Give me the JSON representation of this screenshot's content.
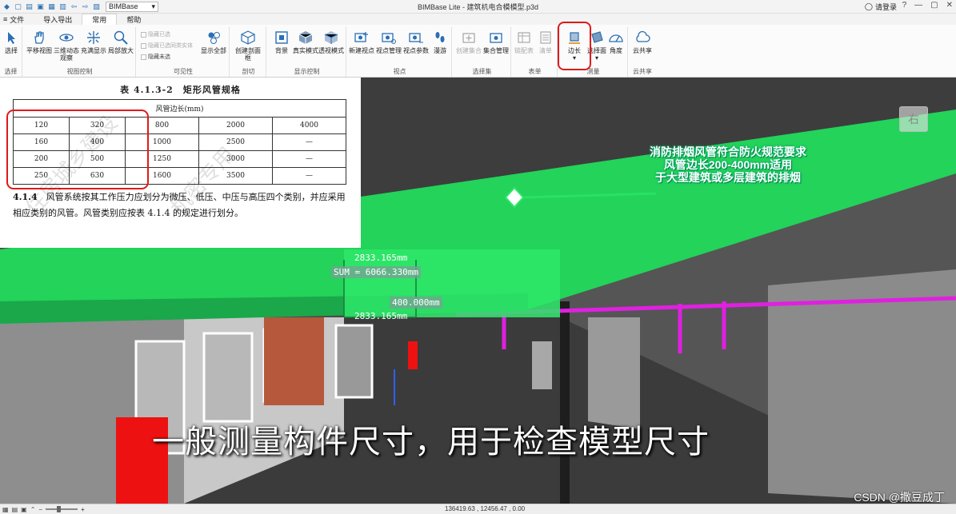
{
  "titlebar": {
    "project_select": "BIMBase",
    "window_title": "BIMBase Lite - 建筑机电合模模型.p3d",
    "login": "请登录"
  },
  "menu": {
    "file": "文件",
    "tabs": [
      "导入导出",
      "常用",
      "帮助"
    ],
    "active_tab": "常用"
  },
  "ribbon": {
    "groups": {
      "select": "选择",
      "view_control": "视图控制",
      "visibility": "可见性",
      "section": "剖切",
      "display_control": "显示控制",
      "viewpoint": "视点",
      "selection_set": "选择集",
      "table": "表单",
      "measure": "测量",
      "cloud": "云共享"
    },
    "buttons": {
      "select": "选择",
      "pan": "平移视图",
      "orbit": "三维动态观察",
      "zoom_fit": "充满显示",
      "zoom_area": "局部放大",
      "hide_selected": "隐藏已选",
      "hide_unselected": "隐藏已选同类实体",
      "hide_unselected2": "隐藏未选",
      "show_all": "显示全部",
      "section_box": "创建剖面框",
      "background": "背景",
      "realistic": "真实模式",
      "perspective": "透视模式",
      "new_viewpoint": "新建视点",
      "viewpoint_manage": "视点管理",
      "viewpoint_params": "视点参数",
      "walk": "漫游",
      "create_set": "创建集合",
      "set_manage": "集合管理",
      "link_form": "链配表",
      "clear_form": "清单",
      "edge_length": "边长",
      "select_face": "选择面",
      "angle": "角度",
      "cloud_share": "云共享"
    }
  },
  "spec_table": {
    "title": "表 4.1.3-2　矩形风管规格",
    "header": "风管边长(mm)",
    "rows": [
      [
        "120",
        "320",
        "800",
        "2000",
        "4000"
      ],
      [
        "160",
        "400",
        "1000",
        "2500",
        "—"
      ],
      [
        "200",
        "500",
        "1250",
        "3000",
        "—"
      ],
      [
        "250",
        "630",
        "1600",
        "3500",
        "—"
      ]
    ],
    "clause_no": "4.1.4",
    "clause_text": "风管系统按其工作压力应划分为微压、低压、中压与高压四个类别，并应采用相应类别的风管。风管类别应按表 4.1.4 的规定进行划分。",
    "watermark_1": "住房城乡建设",
    "watermark_2": "机密专用"
  },
  "measurements": {
    "top": "2833.165mm",
    "sum": "SUM = 6066.330mm",
    "middle": "400.000mm",
    "bottom": "2833.165mm"
  },
  "annotation": {
    "line1": "消防排烟风管符合防火规范要求",
    "line2": "风管边长200-400mm适用",
    "line3": "于大型建筑或多层建筑的排烟"
  },
  "subtitle": "一般测量构件尺寸，用于检查模型尺寸",
  "view_cube_label": "右",
  "status": {
    "coords": "136419.63 , 12456.47 , 0.00"
  },
  "credit": "CSDN @撒豆成丁",
  "colors": {
    "duct_green": "#2ee86a",
    "pipe_magenta": "#e020e0",
    "highlight_red": "#e01a1a"
  }
}
